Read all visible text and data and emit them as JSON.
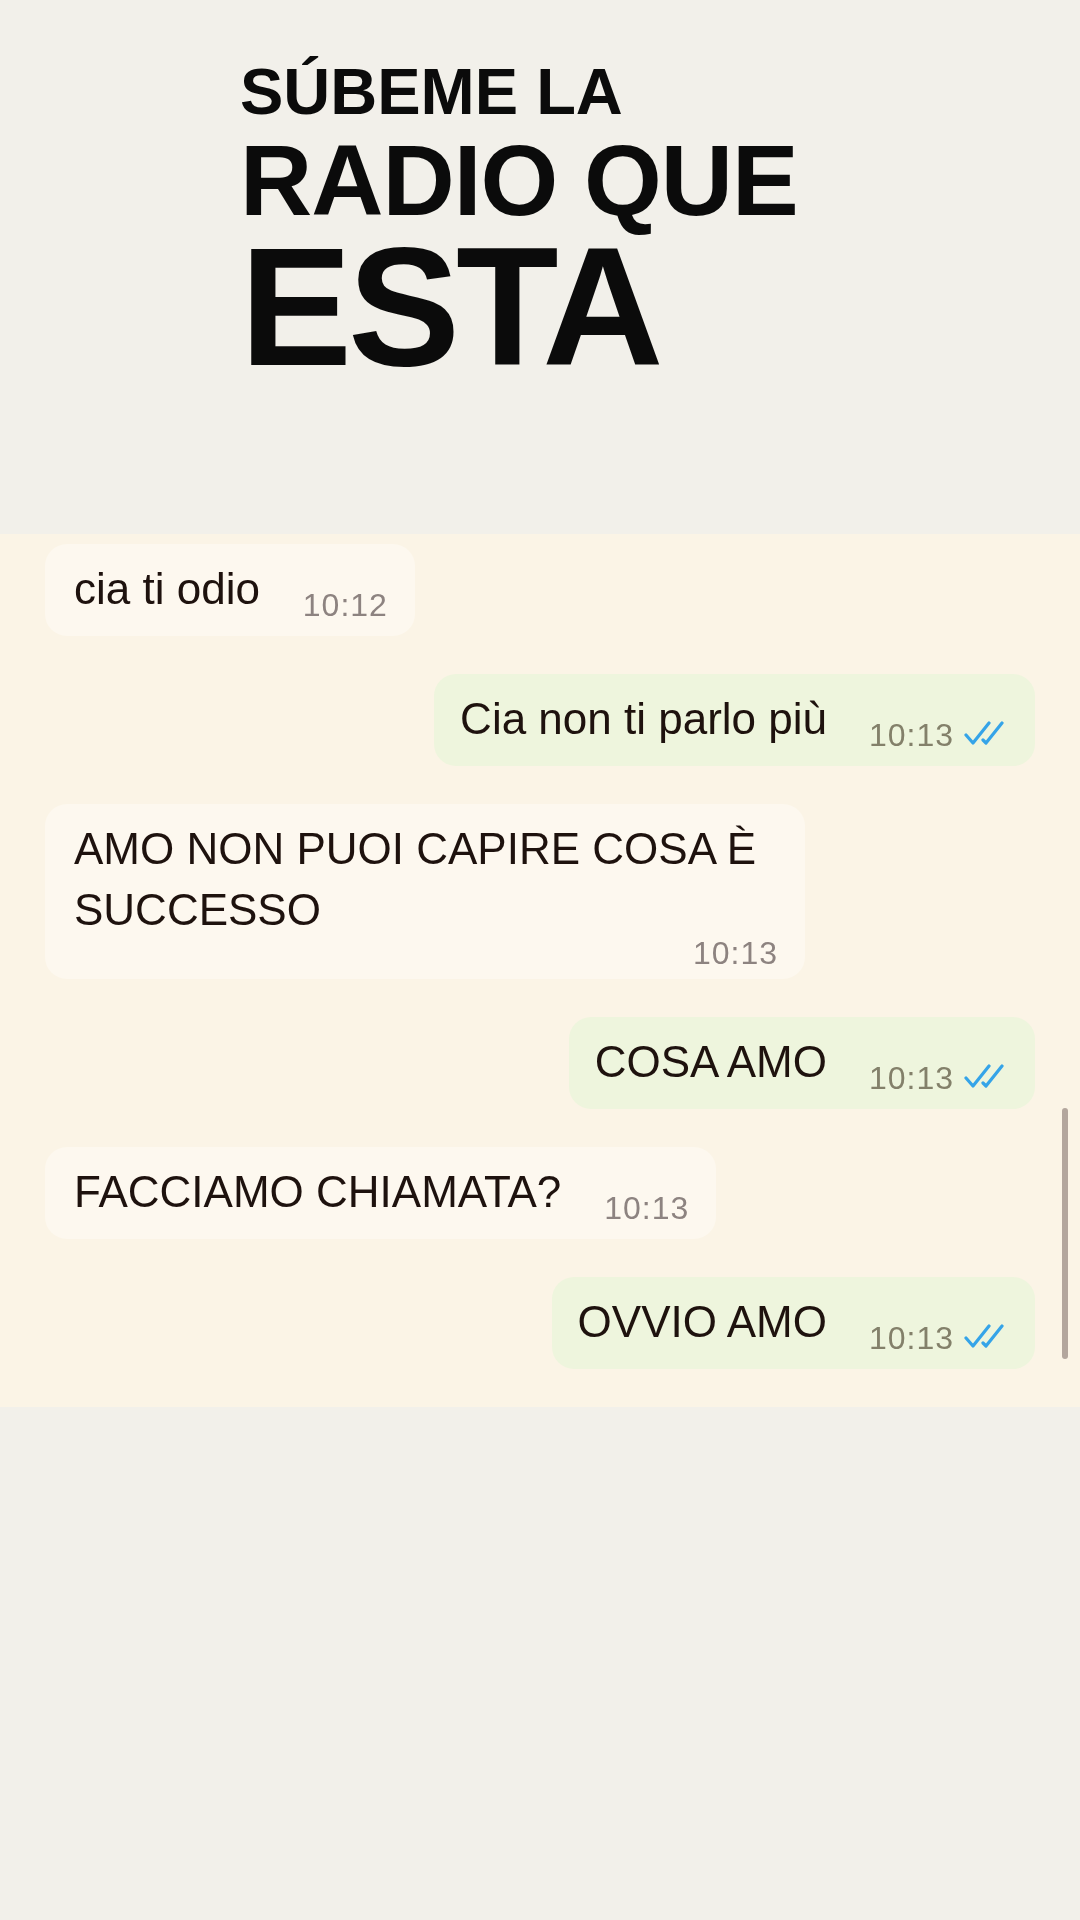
{
  "header": {
    "title_lines": [
      "SÚBEME LA",
      "RADIO QUE",
      "ESTA"
    ]
  },
  "chat": {
    "messages": [
      {
        "kind": "incoming",
        "text": "cia ti odio",
        "time": "10:12"
      },
      {
        "kind": "outgoing",
        "text": "Cia non ti parlo più",
        "time": "10:13",
        "read": true
      },
      {
        "kind": "incoming",
        "text": "AMO NON PUOI CAPIRE COSA È SUCCESSO",
        "time": "10:13"
      },
      {
        "kind": "outgoing",
        "text": "COSA AMO",
        "time": "10:13",
        "read": true
      },
      {
        "kind": "incoming",
        "text": "FACCIAMO CHIAMATA?",
        "time": "10:13"
      },
      {
        "kind": "outgoing",
        "text": "OVVIO AMO",
        "time": "10:13",
        "read": true
      }
    ]
  }
}
